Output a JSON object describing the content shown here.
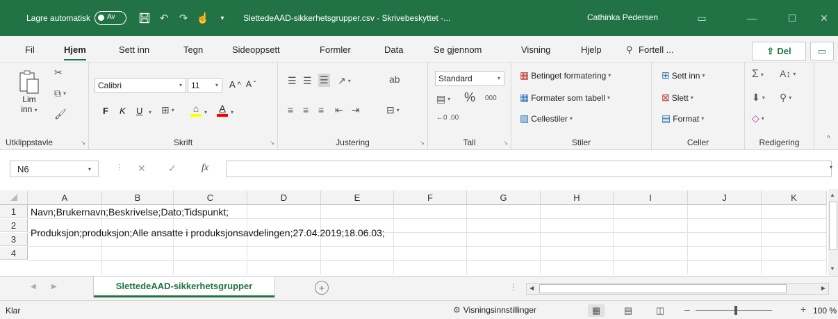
{
  "titlebar": {
    "autosave_label": "Lagre automatisk",
    "autosave_state": "Av",
    "document_title": "SlettedeAAD-sikkerhetsgrupper.csv - Skrivebeskyttet -...",
    "user_name": "Cathinka Pedersen"
  },
  "tabs": [
    "Fil",
    "Hjem",
    "Sett inn",
    "Tegn",
    "Sideoppsett",
    "Formler",
    "Data",
    "Se gjennom",
    "Visning",
    "Hjelp"
  ],
  "active_tab": "Hjem",
  "search_label": "Fortell ...",
  "share_label": "Del",
  "ribbon": {
    "clipboard": {
      "paste_label": "Lim",
      "paste_label2": "inn",
      "group_label": "Utklippstavle"
    },
    "font": {
      "font_name": "Calibri",
      "font_size": "11",
      "bold": "F",
      "italic": "K",
      "underline": "U",
      "group_label": "Skrift",
      "highlight_color": "#FFFF00",
      "font_color": "#FF0000"
    },
    "alignment": {
      "group_label": "Justering"
    },
    "number": {
      "format": "Standard",
      "percent": "%",
      "thousands": "000",
      "group_label": "Tall"
    },
    "styles": {
      "conditional": "Betinget formatering",
      "format_table": "Formater som tabell",
      "cell_styles": "Cellestiler",
      "group_label": "Stiler"
    },
    "cells": {
      "insert": "Sett inn",
      "delete": "Slett",
      "format": "Format",
      "group_label": "Celler"
    },
    "editing": {
      "group_label": "Redigering"
    }
  },
  "formula_bar": {
    "name_box": "N6",
    "fx": "fx",
    "formula": ""
  },
  "grid": {
    "columns": [
      "A",
      "B",
      "C",
      "D",
      "E",
      "F",
      "G",
      "H",
      "I",
      "J",
      "K"
    ],
    "rows": [
      "1",
      "2",
      "3",
      "4"
    ],
    "cells": {
      "A1": "Navn;Brukernavn;Beskrivelse;Dato;Tidspunkt;",
      "A2": "Produksjon;produksjon;Alle ansatte i produksjonsavdelingen;27.04.2019;18.06.03;"
    }
  },
  "sheet_tab": "SlettedeAAD-sikkerhetsgrupper",
  "statusbar": {
    "ready": "Klar",
    "view_settings": "Visningsinnstillinger",
    "zoom": "100 %"
  },
  "colors": {
    "accent": "#217346"
  }
}
